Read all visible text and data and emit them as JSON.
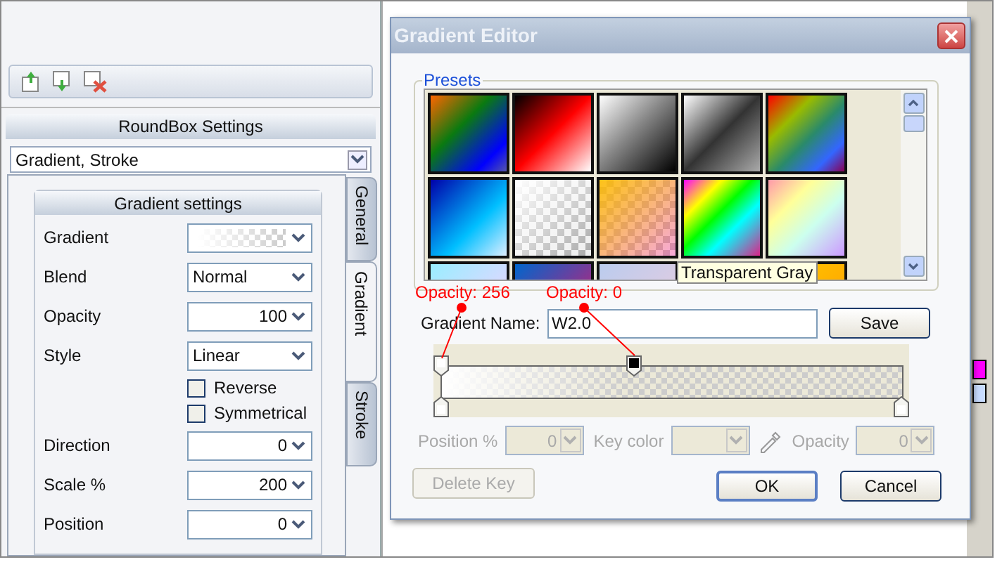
{
  "layers_toolbar": {
    "buttons": [
      {
        "kind": "up"
      },
      {
        "kind": "down"
      },
      {
        "kind": "delete"
      }
    ]
  },
  "settings_panel": {
    "title": "RoundBox Settings",
    "preset_select": {
      "value": "Gradient, Stroke"
    },
    "tabs": [
      {
        "label": "General",
        "selected": false
      },
      {
        "label": "Gradient",
        "selected": true
      },
      {
        "label": "Stroke",
        "selected": false
      }
    ],
    "group_title": "Gradient settings",
    "rows": [
      {
        "kind": "swatch",
        "label": "Gradient"
      },
      {
        "kind": "select",
        "label": "Blend",
        "value": "Normal"
      },
      {
        "kind": "number",
        "label": "Opacity",
        "value": "100"
      },
      {
        "kind": "select",
        "label": "Style",
        "value": "Linear"
      },
      {
        "kind": "checkbox",
        "label": "Reverse",
        "checked": false
      },
      {
        "kind": "checkbox",
        "label": "Symmetrical",
        "checked": false
      },
      {
        "kind": "number",
        "label": "Direction",
        "value": "0"
      },
      {
        "kind": "number",
        "label": "Scale %",
        "value": "200"
      },
      {
        "kind": "number",
        "label": "Position",
        "value": "0"
      }
    ]
  },
  "dialog": {
    "title": "Gradient Editor",
    "presets_title": "Presets",
    "tooltip": "Transparent Gray",
    "annotations": [
      {
        "text": "Opacity: 256"
      },
      {
        "text": "Opacity: 0"
      }
    ],
    "name_label": "Gradient Name:",
    "name_value": "W2.0",
    "save": "Save",
    "stops": [
      {
        "kind": "top",
        "level": 0,
        "color": "#ffffff"
      },
      {
        "kind": "top",
        "level": 0.42,
        "color": "#000000"
      },
      {
        "kind": "bottom",
        "level": 0,
        "color": "#ffffff"
      },
      {
        "kind": "bottom",
        "level": 1,
        "color": "#ffffff"
      }
    ],
    "key_fields": [
      {
        "kind": "number",
        "label": "Position %",
        "value": "0",
        "disabled": true
      },
      {
        "kind": "color",
        "label": "Key color",
        "disabled": true
      },
      {
        "kind": "number",
        "label": "Opacity",
        "value": "0",
        "disabled": true
      }
    ],
    "delete_key": {
      "label": "Delete Key",
      "disabled": true
    },
    "ok": "OK",
    "cancel": "Cancel"
  }
}
